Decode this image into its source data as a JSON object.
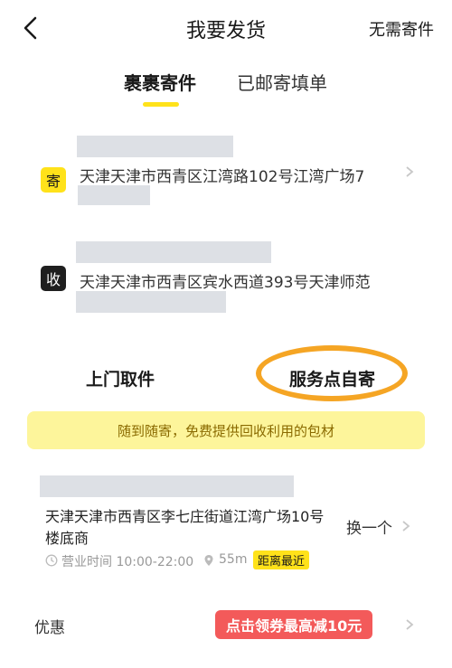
{
  "header": {
    "title": "我要发货",
    "right_action": "无需寄件"
  },
  "tabs": [
    {
      "label": "裹裹寄件",
      "active": true
    },
    {
      "label": "已邮寄填单",
      "active": false
    }
  ],
  "sender": {
    "badge": "寄",
    "address": "天津天津市西青区江湾路102号江湾广场7"
  },
  "receiver": {
    "badge": "收",
    "address": "天津天津市西青区宾水西道393号天津师范"
  },
  "pickup_options": {
    "door": "上门取件",
    "service_point": "服务点自寄"
  },
  "banner": "随到随寄，免费提供回收利用的包材",
  "service_point": {
    "address": "天津天津市西青区李七庄街道江湾广场10号楼底商",
    "change": "换一个",
    "hours": "营业时间 10:00-22:00",
    "distance": "55m",
    "tag": "距离最近"
  },
  "discount": {
    "label": "优惠",
    "coupon": "点击领券最高减10元"
  },
  "colors": {
    "accent_yellow": "#ffe21a",
    "highlight_orange": "#f5a524",
    "coupon_red": "#f35a5a"
  }
}
